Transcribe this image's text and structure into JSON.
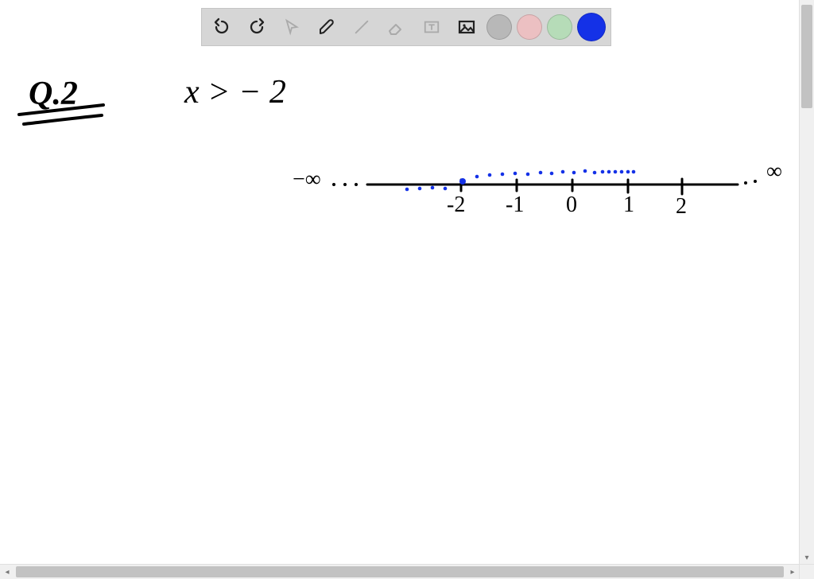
{
  "toolbar": {
    "tools": [
      {
        "name": "undo-icon",
        "enabled": true
      },
      {
        "name": "redo-icon",
        "enabled": true
      },
      {
        "name": "pointer-icon",
        "enabled": false
      },
      {
        "name": "pen-icon",
        "enabled": true
      },
      {
        "name": "tools-icon",
        "enabled": false
      },
      {
        "name": "eraser-icon",
        "enabled": false
      },
      {
        "name": "textbox-icon",
        "enabled": false
      },
      {
        "name": "image-icon",
        "enabled": true
      }
    ],
    "color_swatches": [
      {
        "name": "color-gray",
        "hex": "#b8b8b8",
        "selected": false
      },
      {
        "name": "color-pink",
        "hex": "#ecc0c2",
        "selected": false
      },
      {
        "name": "color-green",
        "hex": "#b6dcb8",
        "selected": false
      },
      {
        "name": "color-blue",
        "hex": "#1431e7",
        "selected": true
      }
    ]
  },
  "handwriting": {
    "question_label": "Q.2",
    "inequality": "x > − 2",
    "neg_inf": "−∞",
    "pos_inf": "∞",
    "ticks": [
      "-2",
      "-1",
      "0",
      "1",
      "2"
    ]
  },
  "chart_data": {
    "type": "line",
    "title": "",
    "xlabel": "",
    "ylabel": "",
    "ticks": [
      -2,
      -1,
      0,
      1,
      2
    ],
    "open_point": -2,
    "shaded_direction": "right",
    "interval": "(-2, ∞)",
    "xlim_labels": [
      "-∞",
      "∞"
    ]
  }
}
